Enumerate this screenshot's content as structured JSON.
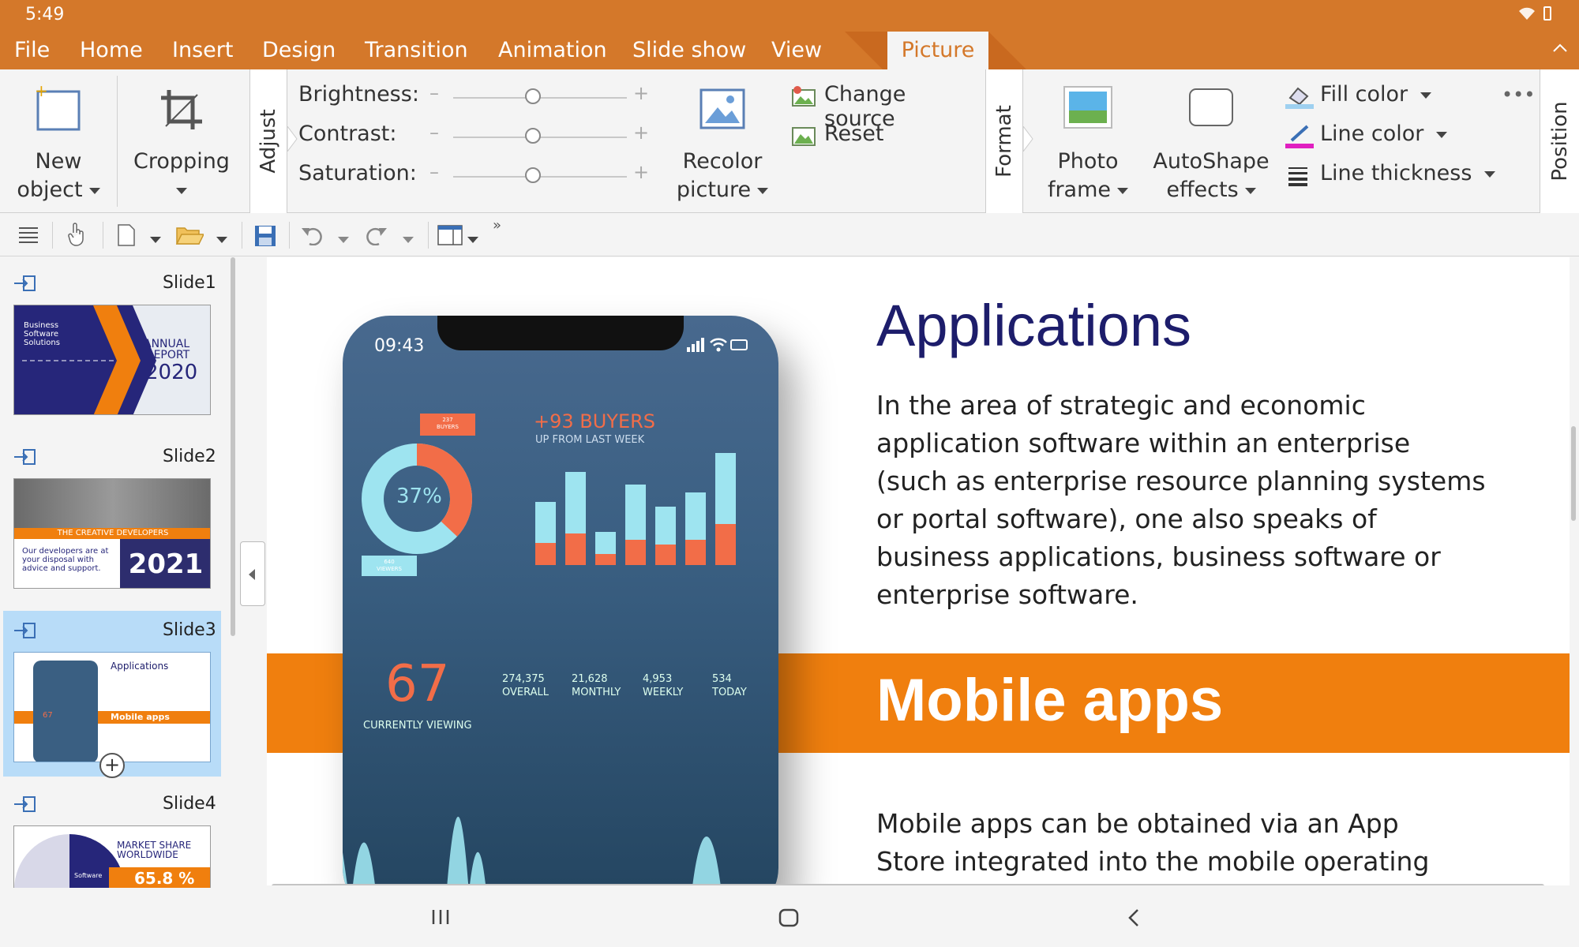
{
  "status": {
    "time": "5:49"
  },
  "menu": {
    "items": [
      "File",
      "Home",
      "Insert",
      "Design",
      "Transition",
      "Animation",
      "Slide show",
      "View"
    ],
    "active_tab": "Picture"
  },
  "ribbon": {
    "new_object": [
      "New",
      "object"
    ],
    "cropping": "Cropping",
    "adjust_tab": "Adjust",
    "brightness": "Brightness:",
    "contrast": "Contrast:",
    "saturation": "Saturation:",
    "recolor": [
      "Recolor",
      "picture"
    ],
    "change_source": "Change source",
    "reset": "Reset",
    "format_tab": "Format",
    "photo_frame": [
      "Photo",
      "frame"
    ],
    "autoshape": [
      "AutoShape",
      "effects"
    ],
    "fill_color": "Fill color",
    "line_color": "Line color",
    "line_thickness": "Line thickness",
    "position_tab": "Position"
  },
  "slides": [
    {
      "label": "Slide1",
      "lines": [
        "Business",
        "Software",
        "Solutions"
      ],
      "title_lines": [
        "ANNUAL",
        "REPORT"
      ],
      "year": "2020"
    },
    {
      "label": "Slide2",
      "banner": "THE CREATIVE DEVELOPERS",
      "text": [
        "Our developers are at",
        "your disposal with",
        "advice and support."
      ],
      "year": "2021"
    },
    {
      "label": "Slide3",
      "title": "Applications",
      "banner": "Mobile apps",
      "num": "67"
    },
    {
      "label": "Slide4",
      "title": [
        "MARKET SHARE",
        "WORLDWIDE"
      ],
      "value": "65.8 %",
      "sub": "Software"
    }
  ],
  "slide": {
    "title": "Applications",
    "body": [
      "In the area of strategic and economic",
      "application software within an enterprise",
      "(such as enterprise resource planning systems",
      "or portal software), one also speaks of",
      "business applications, business software or",
      "enterprise software."
    ],
    "banner": "Mobile apps",
    "body2": [
      "Mobile apps can be obtained via an App",
      "Store integrated into the mobile operating"
    ]
  },
  "phone": {
    "time": "09:43",
    "buyers_badge": [
      "237",
      "BUYERS"
    ],
    "donut_pct": "37%",
    "viewers_badge": [
      "640",
      "VIEWERS"
    ],
    "buyers_head": "+93 BUYERS",
    "buyers_sub": "UP FROM LAST WEEK",
    "big_num": "67",
    "big_label": "CURRENTLY VIEWING",
    "stats": [
      {
        "value": "274,375",
        "label": "OVERALL"
      },
      {
        "value": "21,628",
        "label": "MONTHLY"
      },
      {
        "value": "4,953",
        "label": "WEEKLY"
      },
      {
        "value": "534",
        "label": "TODAY"
      }
    ]
  },
  "colors": {
    "accent": "#d4782a",
    "banner": "#f07f0e",
    "title": "#1d1d6b",
    "phone_bg": "#3a5f82",
    "cyan": "#9ee4f0",
    "coral": "#f26d48"
  }
}
